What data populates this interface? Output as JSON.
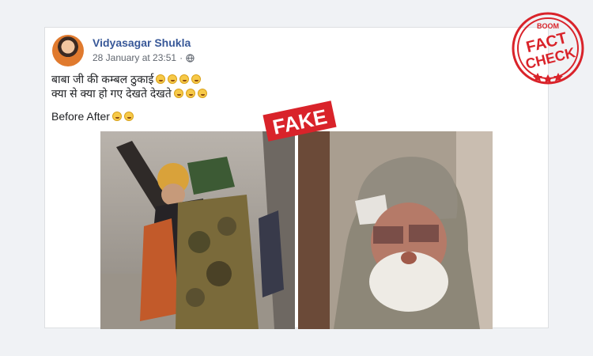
{
  "post": {
    "author": "Vidyasagar Shukla",
    "timestamp": "28 January at 23:51",
    "privacy_icon": "globe-icon",
    "text_line1": "बाबा जी की कम्बल ठुकाई",
    "text_line2": "क्या से क्या हो गए देखते देखते",
    "before_after": "Before After"
  },
  "overlays": {
    "fake_stamp": "FAKE",
    "factcheck_brand": "BOOM",
    "factcheck_line1": "FACT",
    "factcheck_line2": "CHECK"
  },
  "colors": {
    "author_link": "#385898",
    "stamp_red": "#d9232a"
  }
}
